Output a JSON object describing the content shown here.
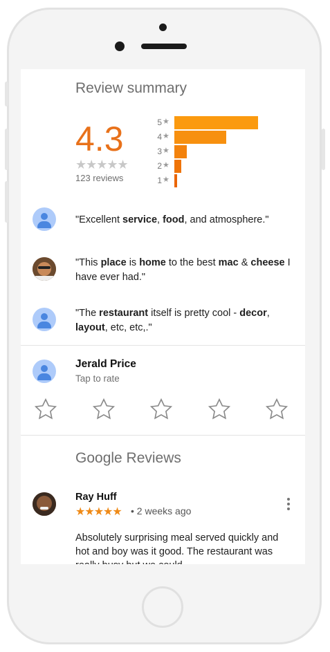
{
  "summary": {
    "title": "Review summary",
    "rating": "4.3",
    "stars_display": "★★★★★",
    "reviews_count": "123 reviews",
    "histogram": [
      {
        "label": "5",
        "fraction": 1.0
      },
      {
        "label": "4",
        "fraction": 0.62
      },
      {
        "label": "3",
        "fraction": 0.15
      },
      {
        "label": "2",
        "fraction": 0.08
      },
      {
        "label": "1",
        "fraction": 0.03
      }
    ],
    "histogram_star": "★"
  },
  "quotes": [
    {
      "parts": [
        [
          "\"Excellent ",
          false
        ],
        [
          "service",
          true
        ],
        [
          ", ",
          false
        ],
        [
          "food",
          true
        ],
        [
          ", and atmosphere.\"",
          false
        ]
      ]
    },
    {
      "parts": [
        [
          "\"This ",
          false
        ],
        [
          "place",
          true
        ],
        [
          " is ",
          false
        ],
        [
          "home",
          true
        ],
        [
          " to the best ",
          false
        ],
        [
          "mac",
          true
        ],
        [
          " & ",
          false
        ],
        [
          "cheese",
          true
        ],
        [
          " I have ever had.\"",
          false
        ]
      ]
    },
    {
      "parts": [
        [
          "\"The ",
          false
        ],
        [
          "restaurant",
          true
        ],
        [
          " itself is pretty cool - ",
          false
        ],
        [
          "decor",
          true
        ],
        [
          ", ",
          false
        ],
        [
          "layout",
          true
        ],
        [
          ", etc, etc,.\"",
          false
        ]
      ]
    }
  ],
  "rate": {
    "user_name": "Jerald Price",
    "prompt": "Tap to rate",
    "star_count": 5
  },
  "google_reviews": {
    "title": "Google Reviews",
    "reviewer": "Ray Huff",
    "stars": "★★★★★",
    "rating": 5,
    "time": "• 2 weeks ago",
    "text": "Absolutely surprising meal served quickly and hot and boy was it good.  The restaurant was really busy but we could"
  },
  "colors": {
    "accent": "#e8711a",
    "bar": "#ef6c00",
    "star_orange": "#ef8a17",
    "avatar_bg": "#aecbfa",
    "avatar_fg": "#4a86e0"
  }
}
